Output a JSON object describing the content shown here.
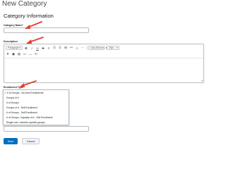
{
  "page": {
    "title": "New Category",
    "section_title": "Category Information"
  },
  "form": {
    "category_name_label": "Category Name*",
    "category_name_value": "",
    "description_label": "Description",
    "enrollment_type_label": "Enrollment Type"
  },
  "editor": {
    "paragraph_select": "Paragraph",
    "font_select": "Lato (Recom...",
    "size_select": "19px ...",
    "toolbar_row1_icons": [
      "bold-icon",
      "italic-icon",
      "underline-icon",
      "strikethrough-icon",
      "align-icon",
      "bullet-list-icon",
      "numbered-list-icon",
      "table-icon",
      "insert-link-icon",
      "emoji-icon",
      "more-icon"
    ],
    "toolbar_row2_icons": [
      "format-painter-icon",
      "insert-image-icon",
      "insert-stuff-icon",
      "insert-media-icon",
      "horizontal-rule-icon",
      "redo-icon"
    ]
  },
  "enrollment_options": [
    {
      "label": "✓ # of Groups - No Auto Enrollments",
      "selected": true
    },
    {
      "label": "Groups of #",
      "selected": false
    },
    {
      "label": "# of Groups",
      "selected": false
    },
    {
      "label": "Groups of # - Self Enrollment",
      "selected": false
    },
    {
      "label": "# of Groups - Self Enrollment",
      "selected": false
    },
    {
      "label": "# of Groups, Capacity of # - Self Enrollment",
      "selected": false
    },
    {
      "label": "Single user, member-specific groups",
      "selected": false
    }
  ],
  "buttons": {
    "save": "Save",
    "cancel": "Cancel"
  },
  "colors": {
    "primary": "#006fbf",
    "annotation_arrow": "#e2402a"
  }
}
